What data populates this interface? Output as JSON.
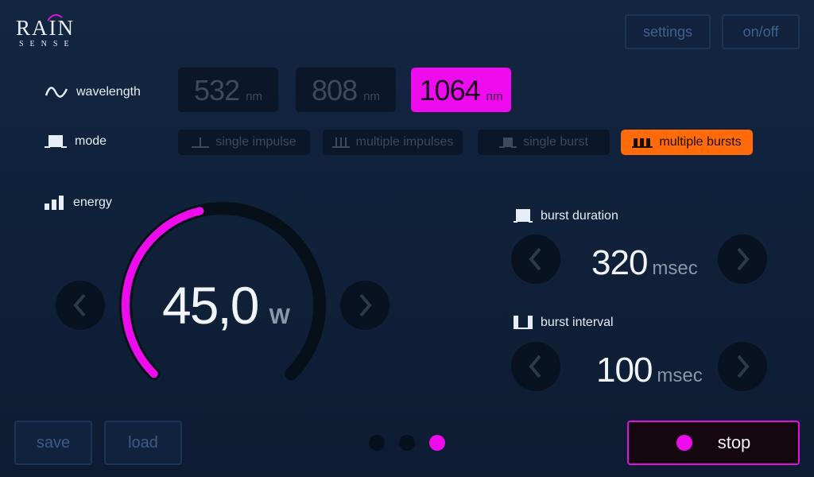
{
  "logo": {
    "main": "RAIN",
    "sub": "SENSE"
  },
  "top_buttons": {
    "settings": "settings",
    "onoff": "on/off"
  },
  "wavelength": {
    "label": "wavelength",
    "options": [
      {
        "value": "532",
        "unit": "nm",
        "active": false
      },
      {
        "value": "808",
        "unit": "nm",
        "active": false
      },
      {
        "value": "1064",
        "unit": "nm",
        "active": true
      }
    ]
  },
  "mode": {
    "label": "mode",
    "options": [
      {
        "label": "single impulse",
        "active": false
      },
      {
        "label": "multiple impulses",
        "active": false
      },
      {
        "label": "single burst",
        "active": false
      },
      {
        "label": "multiple bursts",
        "active": true
      }
    ]
  },
  "energy": {
    "label": "energy",
    "value": "45,0",
    "unit": "W",
    "gauge_fraction": 0.45
  },
  "burst_duration": {
    "label": "burst  duration",
    "value": "320",
    "unit": "msec"
  },
  "burst_interval": {
    "label": "burst  interval",
    "value": "100",
    "unit": "msec"
  },
  "bottom": {
    "save": "save",
    "load": "load",
    "stop": "stop"
  },
  "pager": {
    "count": 3,
    "active_index": 2
  },
  "colors": {
    "accent_magenta": "#ee0cee",
    "accent_orange": "#ff6a0a",
    "background": "#132640"
  }
}
